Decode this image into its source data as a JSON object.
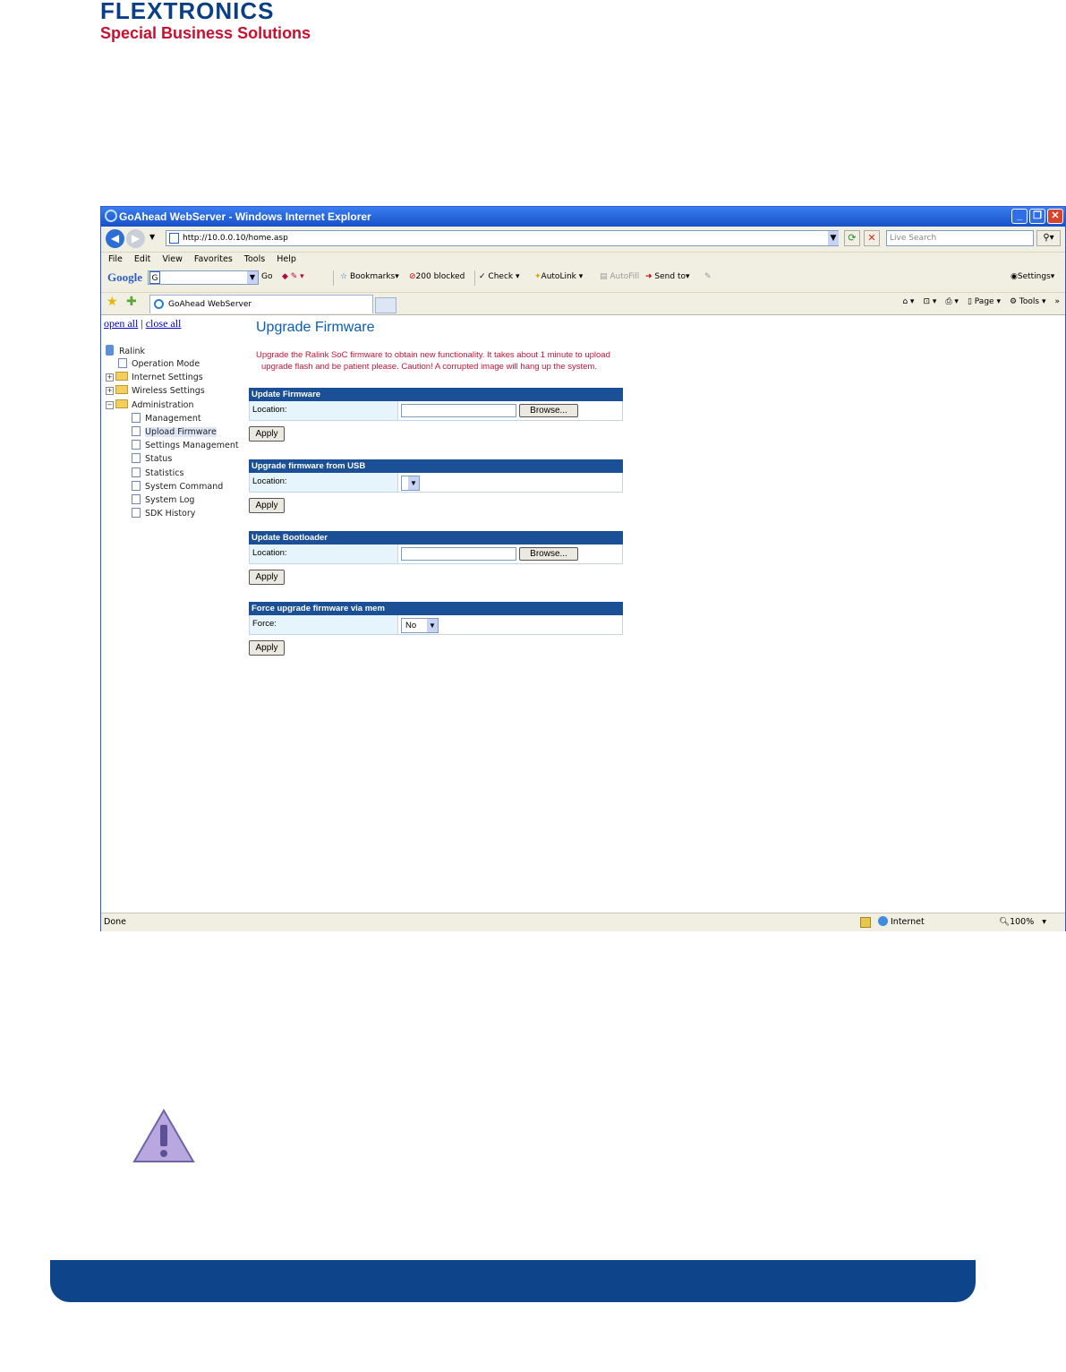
{
  "brand": {
    "name": "FLEXTRONICS",
    "tagline": "Special Business Solutions"
  },
  "browser": {
    "title": "GoAhead WebServer - Windows Internet Explorer",
    "url": "http://10.0.0.10/home.asp",
    "search_placeholder": "Live Search",
    "menus": [
      "File",
      "Edit",
      "View",
      "Favorites",
      "Tools",
      "Help"
    ],
    "google_toolbar": {
      "label": "Google",
      "go": "Go",
      "bookmarks": "Bookmarks",
      "blocked": "200 blocked",
      "check": "Check",
      "autolink": "AutoLink",
      "autofill": "AutoFill",
      "sendto": "Send to",
      "settings": "Settings"
    },
    "tab_label": "GoAhead WebServer",
    "right_tools": {
      "page": "Page",
      "tools": "Tools"
    },
    "status": {
      "text": "Done",
      "zone": "Internet",
      "zoom": "100%"
    }
  },
  "tree": {
    "open_all": "open all",
    "separator": "|",
    "close_all": "close all",
    "root": "Ralink",
    "items": {
      "operation_mode": "Operation Mode",
      "internet_settings": "Internet Settings",
      "wireless_settings": "Wireless Settings",
      "administration": "Administration",
      "management": "Management",
      "upload_firmware": "Upload Firmware",
      "settings_management": "Settings Management",
      "status": "Status",
      "statistics": "Statistics",
      "system_command": "System Command",
      "system_log": "System Log",
      "sdk_history": "SDK History"
    }
  },
  "page": {
    "title": "Upgrade Firmware",
    "desc_line1": "Upgrade the Ralink SoC firmware to obtain new functionality. It takes about 1 minute to upload",
    "desc_line2": "upgrade flash and be patient please. Caution! A corrupted image will hang up the system.",
    "sections": {
      "update_firmware": {
        "title": "Update Firmware",
        "label": "Location:",
        "browse": "Browse...",
        "apply": "Apply"
      },
      "usb": {
        "title": "Upgrade firmware from USB",
        "label": "Location:",
        "apply": "Apply"
      },
      "bootloader": {
        "title": "Update Bootloader",
        "label": "Location:",
        "browse": "Browse...",
        "apply": "Apply"
      },
      "force": {
        "title": "Force upgrade firmware via mem",
        "label": "Force:",
        "value": "No",
        "apply": "Apply"
      }
    }
  },
  "colors": {
    "brand_blue": "#0a3f86",
    "brand_red": "#c8102e",
    "section_header": "#1b4f96",
    "warning_red": "#c0153b"
  },
  "icons": {
    "warning": "warning-triangle-icon"
  }
}
